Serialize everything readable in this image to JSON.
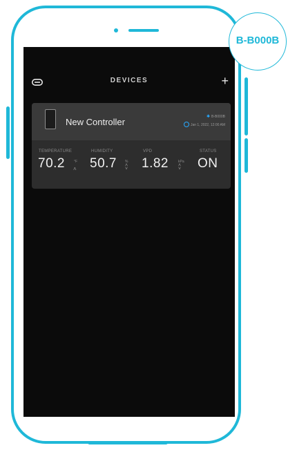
{
  "badge": {
    "text": "B-B000B"
  },
  "header": {
    "title": "DEVICES",
    "add_icon": "+"
  },
  "device": {
    "name": "New Controller",
    "bt_label": "B-B000B",
    "timestamp": "Jan 1, 2022, 12:00 AM",
    "metrics": {
      "temperature": {
        "label": "TEMPERATURE",
        "value": "70.2",
        "unit": "°F",
        "trend": "up"
      },
      "humidity": {
        "label": "HUMIDITY",
        "value": "50.7",
        "unit": "%",
        "trend": "updown"
      },
      "vpd": {
        "label": "VPD",
        "value": "1.82",
        "unit": "kPa",
        "trend": "updown"
      },
      "status": {
        "label": "STATUS",
        "value": "ON"
      }
    }
  },
  "colors": {
    "accent": "#1fb8d8",
    "screen_bg": "#0b0b0b",
    "card_bg": "#2d2d2d",
    "bluetooth": "#27a9ff"
  }
}
